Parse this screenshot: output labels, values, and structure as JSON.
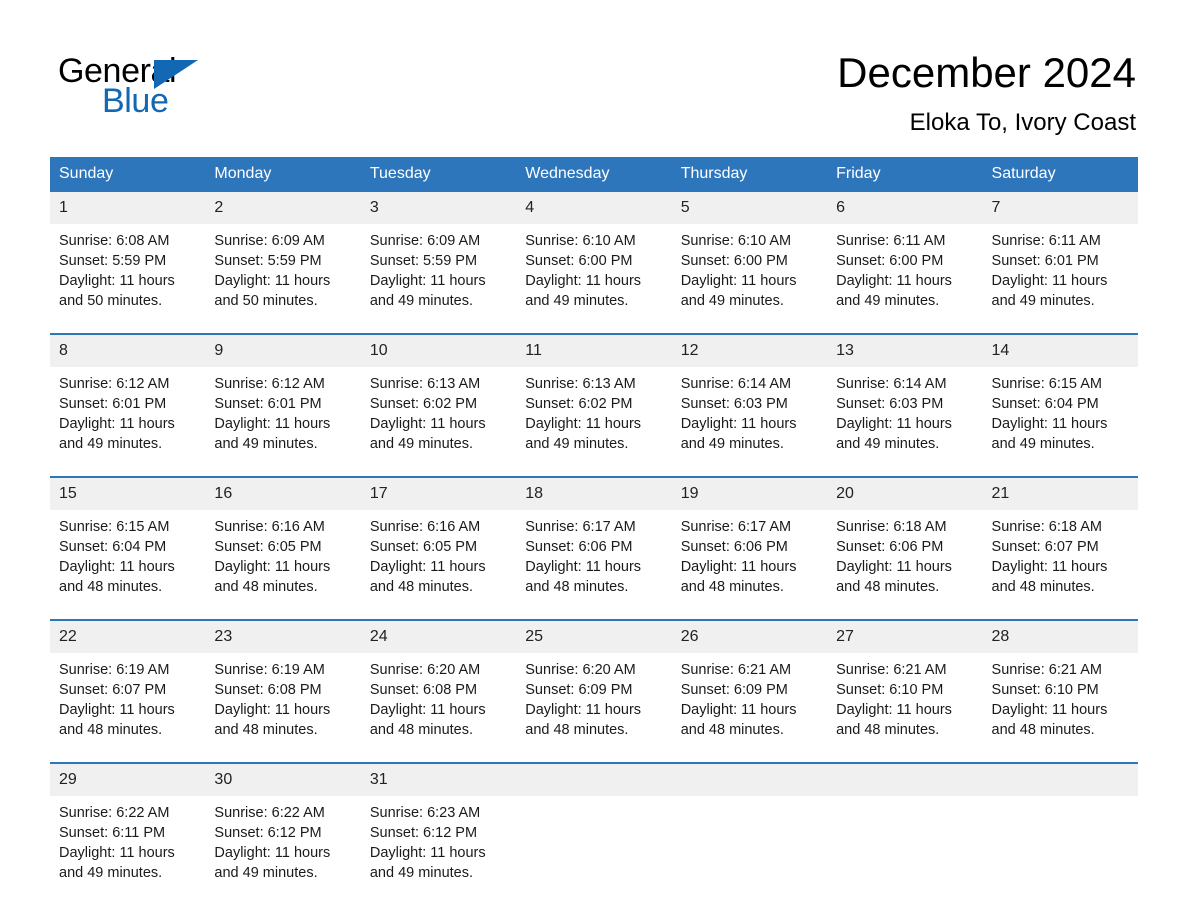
{
  "brand": {
    "name_part1": "General",
    "name_part2": "Blue",
    "triangle_icon": "triangle-icon",
    "color_blue": "#1268b3"
  },
  "header": {
    "title": "December 2024",
    "subtitle": "Eloka To, Ivory Coast"
  },
  "theme": {
    "header_blue": "#2e76bb",
    "daynum_band_gray": "#f0f0f0",
    "text_black": "#000000"
  },
  "weekdays": [
    "Sunday",
    "Monday",
    "Tuesday",
    "Wednesday",
    "Thursday",
    "Friday",
    "Saturday"
  ],
  "weeks": [
    [
      {
        "day": "1",
        "lines": [
          "Sunrise: 6:08 AM",
          "Sunset: 5:59 PM",
          "Daylight: 11 hours",
          "and 50 minutes."
        ]
      },
      {
        "day": "2",
        "lines": [
          "Sunrise: 6:09 AM",
          "Sunset: 5:59 PM",
          "Daylight: 11 hours",
          "and 50 minutes."
        ]
      },
      {
        "day": "3",
        "lines": [
          "Sunrise: 6:09 AM",
          "Sunset: 5:59 PM",
          "Daylight: 11 hours",
          "and 49 minutes."
        ]
      },
      {
        "day": "4",
        "lines": [
          "Sunrise: 6:10 AM",
          "Sunset: 6:00 PM",
          "Daylight: 11 hours",
          "and 49 minutes."
        ]
      },
      {
        "day": "5",
        "lines": [
          "Sunrise: 6:10 AM",
          "Sunset: 6:00 PM",
          "Daylight: 11 hours",
          "and 49 minutes."
        ]
      },
      {
        "day": "6",
        "lines": [
          "Sunrise: 6:11 AM",
          "Sunset: 6:00 PM",
          "Daylight: 11 hours",
          "and 49 minutes."
        ]
      },
      {
        "day": "7",
        "lines": [
          "Sunrise: 6:11 AM",
          "Sunset: 6:01 PM",
          "Daylight: 11 hours",
          "and 49 minutes."
        ]
      }
    ],
    [
      {
        "day": "8",
        "lines": [
          "Sunrise: 6:12 AM",
          "Sunset: 6:01 PM",
          "Daylight: 11 hours",
          "and 49 minutes."
        ]
      },
      {
        "day": "9",
        "lines": [
          "Sunrise: 6:12 AM",
          "Sunset: 6:01 PM",
          "Daylight: 11 hours",
          "and 49 minutes."
        ]
      },
      {
        "day": "10",
        "lines": [
          "Sunrise: 6:13 AM",
          "Sunset: 6:02 PM",
          "Daylight: 11 hours",
          "and 49 minutes."
        ]
      },
      {
        "day": "11",
        "lines": [
          "Sunrise: 6:13 AM",
          "Sunset: 6:02 PM",
          "Daylight: 11 hours",
          "and 49 minutes."
        ]
      },
      {
        "day": "12",
        "lines": [
          "Sunrise: 6:14 AM",
          "Sunset: 6:03 PM",
          "Daylight: 11 hours",
          "and 49 minutes."
        ]
      },
      {
        "day": "13",
        "lines": [
          "Sunrise: 6:14 AM",
          "Sunset: 6:03 PM",
          "Daylight: 11 hours",
          "and 49 minutes."
        ]
      },
      {
        "day": "14",
        "lines": [
          "Sunrise: 6:15 AM",
          "Sunset: 6:04 PM",
          "Daylight: 11 hours",
          "and 49 minutes."
        ]
      }
    ],
    [
      {
        "day": "15",
        "lines": [
          "Sunrise: 6:15 AM",
          "Sunset: 6:04 PM",
          "Daylight: 11 hours",
          "and 48 minutes."
        ]
      },
      {
        "day": "16",
        "lines": [
          "Sunrise: 6:16 AM",
          "Sunset: 6:05 PM",
          "Daylight: 11 hours",
          "and 48 minutes."
        ]
      },
      {
        "day": "17",
        "lines": [
          "Sunrise: 6:16 AM",
          "Sunset: 6:05 PM",
          "Daylight: 11 hours",
          "and 48 minutes."
        ]
      },
      {
        "day": "18",
        "lines": [
          "Sunrise: 6:17 AM",
          "Sunset: 6:06 PM",
          "Daylight: 11 hours",
          "and 48 minutes."
        ]
      },
      {
        "day": "19",
        "lines": [
          "Sunrise: 6:17 AM",
          "Sunset: 6:06 PM",
          "Daylight: 11 hours",
          "and 48 minutes."
        ]
      },
      {
        "day": "20",
        "lines": [
          "Sunrise: 6:18 AM",
          "Sunset: 6:06 PM",
          "Daylight: 11 hours",
          "and 48 minutes."
        ]
      },
      {
        "day": "21",
        "lines": [
          "Sunrise: 6:18 AM",
          "Sunset: 6:07 PM",
          "Daylight: 11 hours",
          "and 48 minutes."
        ]
      }
    ],
    [
      {
        "day": "22",
        "lines": [
          "Sunrise: 6:19 AM",
          "Sunset: 6:07 PM",
          "Daylight: 11 hours",
          "and 48 minutes."
        ]
      },
      {
        "day": "23",
        "lines": [
          "Sunrise: 6:19 AM",
          "Sunset: 6:08 PM",
          "Daylight: 11 hours",
          "and 48 minutes."
        ]
      },
      {
        "day": "24",
        "lines": [
          "Sunrise: 6:20 AM",
          "Sunset: 6:08 PM",
          "Daylight: 11 hours",
          "and 48 minutes."
        ]
      },
      {
        "day": "25",
        "lines": [
          "Sunrise: 6:20 AM",
          "Sunset: 6:09 PM",
          "Daylight: 11 hours",
          "and 48 minutes."
        ]
      },
      {
        "day": "26",
        "lines": [
          "Sunrise: 6:21 AM",
          "Sunset: 6:09 PM",
          "Daylight: 11 hours",
          "and 48 minutes."
        ]
      },
      {
        "day": "27",
        "lines": [
          "Sunrise: 6:21 AM",
          "Sunset: 6:10 PM",
          "Daylight: 11 hours",
          "and 48 minutes."
        ]
      },
      {
        "day": "28",
        "lines": [
          "Sunrise: 6:21 AM",
          "Sunset: 6:10 PM",
          "Daylight: 11 hours",
          "and 48 minutes."
        ]
      }
    ],
    [
      {
        "day": "29",
        "lines": [
          "Sunrise: 6:22 AM",
          "Sunset: 6:11 PM",
          "Daylight: 11 hours",
          "and 49 minutes."
        ]
      },
      {
        "day": "30",
        "lines": [
          "Sunrise: 6:22 AM",
          "Sunset: 6:12 PM",
          "Daylight: 11 hours",
          "and 49 minutes."
        ]
      },
      {
        "day": "31",
        "lines": [
          "Sunrise: 6:23 AM",
          "Sunset: 6:12 PM",
          "Daylight: 11 hours",
          "and 49 minutes."
        ]
      },
      {
        "day": "",
        "lines": []
      },
      {
        "day": "",
        "lines": []
      },
      {
        "day": "",
        "lines": []
      },
      {
        "day": "",
        "lines": []
      }
    ]
  ]
}
